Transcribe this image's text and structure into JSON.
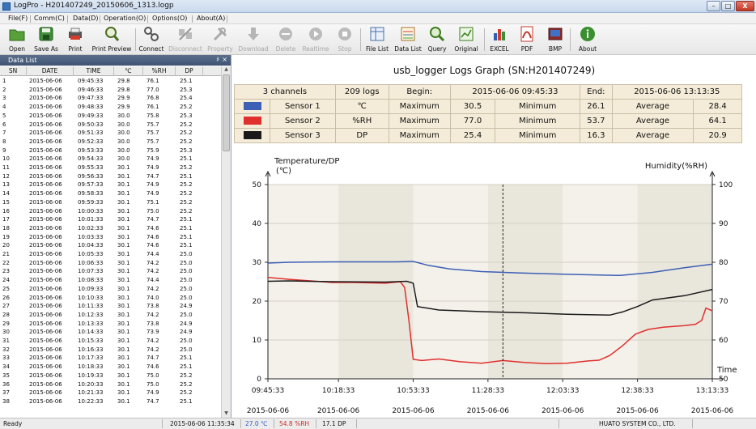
{
  "window": {
    "title": "LogPro - H201407249_20150606_1313.logp",
    "min": "–",
    "max": "□",
    "close": "X"
  },
  "menu": [
    "File(F)",
    "Comm(C)",
    "Data(D)",
    "Operation(O)",
    "Options(O)",
    "About(A)"
  ],
  "toolbar": [
    {
      "label": "Open",
      "icon": "folder-icon",
      "enabled": true
    },
    {
      "label": "Save As",
      "icon": "save-icon",
      "enabled": true
    },
    {
      "label": "Print",
      "icon": "printer-icon",
      "enabled": true
    },
    {
      "label": "Print Preview",
      "icon": "print-preview-icon",
      "enabled": true
    },
    {
      "label": "Connect",
      "icon": "connect-icon",
      "enabled": true
    },
    {
      "label": "Disconnect",
      "icon": "disconnect-icon",
      "enabled": false
    },
    {
      "label": "Property",
      "icon": "tools-icon",
      "enabled": false
    },
    {
      "label": "Download",
      "icon": "download-icon",
      "enabled": false
    },
    {
      "label": "Delete",
      "icon": "delete-icon",
      "enabled": false
    },
    {
      "label": "Realtime",
      "icon": "play-icon",
      "enabled": false
    },
    {
      "label": "Stop",
      "icon": "stop-icon",
      "enabled": false
    },
    {
      "label": "File List",
      "icon": "file-list-icon",
      "enabled": true
    },
    {
      "label": "Data List",
      "icon": "data-list-icon",
      "enabled": true
    },
    {
      "label": "Query",
      "icon": "magnifier-icon",
      "enabled": true
    },
    {
      "label": "Original",
      "icon": "original-chart-icon",
      "enabled": true
    },
    {
      "label": "EXCEL",
      "icon": "excel-icon",
      "enabled": true
    },
    {
      "label": "PDF",
      "icon": "pdf-icon",
      "enabled": true
    },
    {
      "label": "BMP",
      "icon": "bmp-icon",
      "enabled": true
    },
    {
      "label": "About",
      "icon": "info-icon",
      "enabled": true
    }
  ],
  "data_list": {
    "title": "Data List",
    "pin": "♯",
    "close": "×",
    "columns": [
      "SN",
      "DATE",
      "TIME",
      "℃",
      "%RH",
      "DP"
    ],
    "rows": [
      [
        "1",
        "2015-06-06",
        "09:45:33",
        "29.8",
        "76.1",
        "25.1"
      ],
      [
        "2",
        "2015-06-06",
        "09:46:33",
        "29.8",
        "77.0",
        "25.3"
      ],
      [
        "3",
        "2015-06-06",
        "09:47:33",
        "29.9",
        "76.8",
        "25.4"
      ],
      [
        "4",
        "2015-06-06",
        "09:48:33",
        "29.9",
        "76.1",
        "25.2"
      ],
      [
        "5",
        "2015-06-06",
        "09:49:33",
        "30.0",
        "75.8",
        "25.3"
      ],
      [
        "6",
        "2015-06-06",
        "09:50:33",
        "30.0",
        "75.7",
        "25.2"
      ],
      [
        "7",
        "2015-06-06",
        "09:51:33",
        "30.0",
        "75.7",
        "25.2"
      ],
      [
        "8",
        "2015-06-06",
        "09:52:33",
        "30.0",
        "75.7",
        "25.2"
      ],
      [
        "9",
        "2015-06-06",
        "09:53:33",
        "30.0",
        "75.9",
        "25.3"
      ],
      [
        "10",
        "2015-06-06",
        "09:54:33",
        "30.0",
        "74.9",
        "25.1"
      ],
      [
        "11",
        "2015-06-06",
        "09:55:33",
        "30.1",
        "74.9",
        "25.2"
      ],
      [
        "12",
        "2015-06-06",
        "09:56:33",
        "30.1",
        "74.7",
        "25.1"
      ],
      [
        "13",
        "2015-06-06",
        "09:57:33",
        "30.1",
        "74.9",
        "25.2"
      ],
      [
        "14",
        "2015-06-06",
        "09:58:33",
        "30.1",
        "74.9",
        "25.2"
      ],
      [
        "15",
        "2015-06-06",
        "09:59:33",
        "30.1",
        "75.1",
        "25.2"
      ],
      [
        "16",
        "2015-06-06",
        "10:00:33",
        "30.1",
        "75.0",
        "25.2"
      ],
      [
        "17",
        "2015-06-06",
        "10:01:33",
        "30.1",
        "74.7",
        "25.1"
      ],
      [
        "18",
        "2015-06-06",
        "10:02:33",
        "30.1",
        "74.6",
        "25.1"
      ],
      [
        "19",
        "2015-06-06",
        "10:03:33",
        "30.1",
        "74.6",
        "25.1"
      ],
      [
        "20",
        "2015-06-06",
        "10:04:33",
        "30.1",
        "74.6",
        "25.1"
      ],
      [
        "21",
        "2015-06-06",
        "10:05:33",
        "30.1",
        "74.4",
        "25.0"
      ],
      [
        "22",
        "2015-06-06",
        "10:06:33",
        "30.1",
        "74.2",
        "25.0"
      ],
      [
        "23",
        "2015-06-06",
        "10:07:33",
        "30.1",
        "74.2",
        "25.0"
      ],
      [
        "24",
        "2015-06-06",
        "10:08:33",
        "30.1",
        "74.4",
        "25.0"
      ],
      [
        "25",
        "2015-06-06",
        "10:09:33",
        "30.1",
        "74.2",
        "25.0"
      ],
      [
        "26",
        "2015-06-06",
        "10:10:33",
        "30.1",
        "74.0",
        "25.0"
      ],
      [
        "27",
        "2015-06-06",
        "10:11:33",
        "30.1",
        "73.8",
        "24.9"
      ],
      [
        "28",
        "2015-06-06",
        "10:12:33",
        "30.1",
        "74.2",
        "25.0"
      ],
      [
        "29",
        "2015-06-06",
        "10:13:33",
        "30.1",
        "73.8",
        "24.9"
      ],
      [
        "30",
        "2015-06-06",
        "10:14:33",
        "30.1",
        "73.9",
        "24.9"
      ],
      [
        "31",
        "2015-06-06",
        "10:15:33",
        "30.1",
        "74.2",
        "25.0"
      ],
      [
        "32",
        "2015-06-06",
        "10:16:33",
        "30.1",
        "74.2",
        "25.0"
      ],
      [
        "33",
        "2015-06-06",
        "10:17:33",
        "30.1",
        "74.7",
        "25.1"
      ],
      [
        "34",
        "2015-06-06",
        "10:18:33",
        "30.1",
        "74.6",
        "25.1"
      ],
      [
        "35",
        "2015-06-06",
        "10:19:33",
        "30.1",
        "75.0",
        "25.2"
      ],
      [
        "36",
        "2015-06-06",
        "10:20:33",
        "30.1",
        "75.0",
        "25.2"
      ],
      [
        "37",
        "2015-06-06",
        "10:21:33",
        "30.1",
        "74.9",
        "25.2"
      ],
      [
        "38",
        "2015-06-06",
        "10:22:33",
        "30.1",
        "74.7",
        "25.1"
      ]
    ]
  },
  "graph": {
    "title": "usb_logger Logs Graph (SN:H201407249)",
    "summary": {
      "channels": "3 channels",
      "logs": "209 logs",
      "begin_label": "Begin:",
      "begin": "2015-06-06 09:45:33",
      "end_label": "End:",
      "end": "2015-06-06 13:13:35"
    },
    "sensors": [
      {
        "name": "Sensor 1",
        "unit": "℃",
        "max_label": "Maximum",
        "max": "30.5",
        "min_label": "Minimum",
        "min": "26.1",
        "avg_label": "Average",
        "avg": "28.4",
        "color": "#3d5fb5"
      },
      {
        "name": "Sensor 2",
        "unit": "%RH",
        "max_label": "Maximum",
        "max": "77.0",
        "min_label": "Minimum",
        "min": "53.7",
        "avg_label": "Average",
        "avg": "64.1",
        "color": "#e0302e"
      },
      {
        "name": "Sensor 3",
        "unit": "DP",
        "max_label": "Maximum",
        "max": "25.4",
        "min_label": "Minimum",
        "min": "16.3",
        "avg_label": "Average",
        "avg": "20.9",
        "color": "#1a1a1a"
      }
    ]
  },
  "chart_data": {
    "type": "line",
    "ylabel_left_1": "Temperature/DP",
    "ylabel_left_2": "(℃)",
    "ylabel_right": "Humidity(%RH)",
    "xlabel": "Time",
    "ylim_left": [
      0,
      50
    ],
    "ylim_right": [
      50,
      100
    ],
    "yticks_left": [
      "0",
      "10",
      "20",
      "30",
      "40",
      "50"
    ],
    "yticks_right": [
      "50",
      "60",
      "70",
      "80",
      "90",
      "100"
    ],
    "xlim_min": [
      0,
      208
    ],
    "xticks": [
      {
        "m": 0,
        "time": "09:45:33",
        "date": "2015-06-06"
      },
      {
        "m": 33,
        "time": "10:18:33",
        "date": "2015-06-06"
      },
      {
        "m": 68,
        "time": "10:53:33",
        "date": "2015-06-06"
      },
      {
        "m": 103,
        "time": "11:28:33",
        "date": "2015-06-06"
      },
      {
        "m": 138,
        "time": "12:03:33",
        "date": "2015-06-06"
      },
      {
        "m": 173,
        "time": "12:38:33",
        "date": "2015-06-06"
      },
      {
        "m": 208,
        "time": "13:13:33",
        "date": "2015-06-06"
      }
    ],
    "cursor_minute": 110,
    "series": [
      {
        "name": "Sensor 1",
        "axis": "left",
        "color": "#3d5fb5",
        "points": [
          [
            0,
            29.8
          ],
          [
            10,
            30.0
          ],
          [
            30,
            30.1
          ],
          [
            60,
            30.1
          ],
          [
            68,
            30.2
          ],
          [
            75,
            29.2
          ],
          [
            85,
            28.3
          ],
          [
            100,
            27.6
          ],
          [
            120,
            27.2
          ],
          [
            140,
            26.9
          ],
          [
            165,
            26.6
          ],
          [
            180,
            27.4
          ],
          [
            195,
            28.6
          ],
          [
            208,
            29.5
          ]
        ]
      },
      {
        "name": "Sensor 2",
        "axis": "right",
        "color": "#e0302e",
        "points": [
          [
            0,
            76.1
          ],
          [
            10,
            75.6
          ],
          [
            20,
            75.2
          ],
          [
            30,
            74.8
          ],
          [
            40,
            74.8
          ],
          [
            55,
            74.6
          ],
          [
            62,
            75.0
          ],
          [
            64,
            73.5
          ],
          [
            66,
            65.0
          ],
          [
            68,
            55.0
          ],
          [
            72,
            54.7
          ],
          [
            80,
            55.1
          ],
          [
            90,
            54.4
          ],
          [
            100,
            54.0
          ],
          [
            110,
            54.7
          ],
          [
            120,
            54.2
          ],
          [
            130,
            53.9
          ],
          [
            140,
            54.0
          ],
          [
            150,
            54.6
          ],
          [
            155,
            54.8
          ],
          [
            160,
            56.0
          ],
          [
            166,
            58.5
          ],
          [
            172,
            61.5
          ],
          [
            178,
            62.7
          ],
          [
            185,
            63.3
          ],
          [
            195,
            63.7
          ],
          [
            200,
            64.0
          ],
          [
            203,
            65.0
          ],
          [
            205,
            68.2
          ],
          [
            208,
            67.5
          ]
        ]
      },
      {
        "name": "Sensor 3",
        "axis": "left",
        "color": "#1a1a1a",
        "points": [
          [
            0,
            25.1
          ],
          [
            10,
            25.2
          ],
          [
            30,
            25.0
          ],
          [
            55,
            24.9
          ],
          [
            65,
            25.1
          ],
          [
            68,
            24.6
          ],
          [
            70,
            18.6
          ],
          [
            80,
            17.7
          ],
          [
            100,
            17.3
          ],
          [
            120,
            17.0
          ],
          [
            140,
            16.6
          ],
          [
            160,
            16.4
          ],
          [
            166,
            17.2
          ],
          [
            173,
            18.6
          ],
          [
            180,
            20.3
          ],
          [
            195,
            21.4
          ],
          [
            208,
            23.0
          ]
        ]
      }
    ]
  },
  "status": {
    "ready": "Ready",
    "datetime": "2015-06-06 11:35:34",
    "temp": "27.0 ℃",
    "rh": "54.8 %RH",
    "dp": "17.1 DP",
    "company": "HUATO SYSTEM CO., LTD.",
    "temp_color": "#2b58c8",
    "rh_color": "#d22a2a"
  }
}
